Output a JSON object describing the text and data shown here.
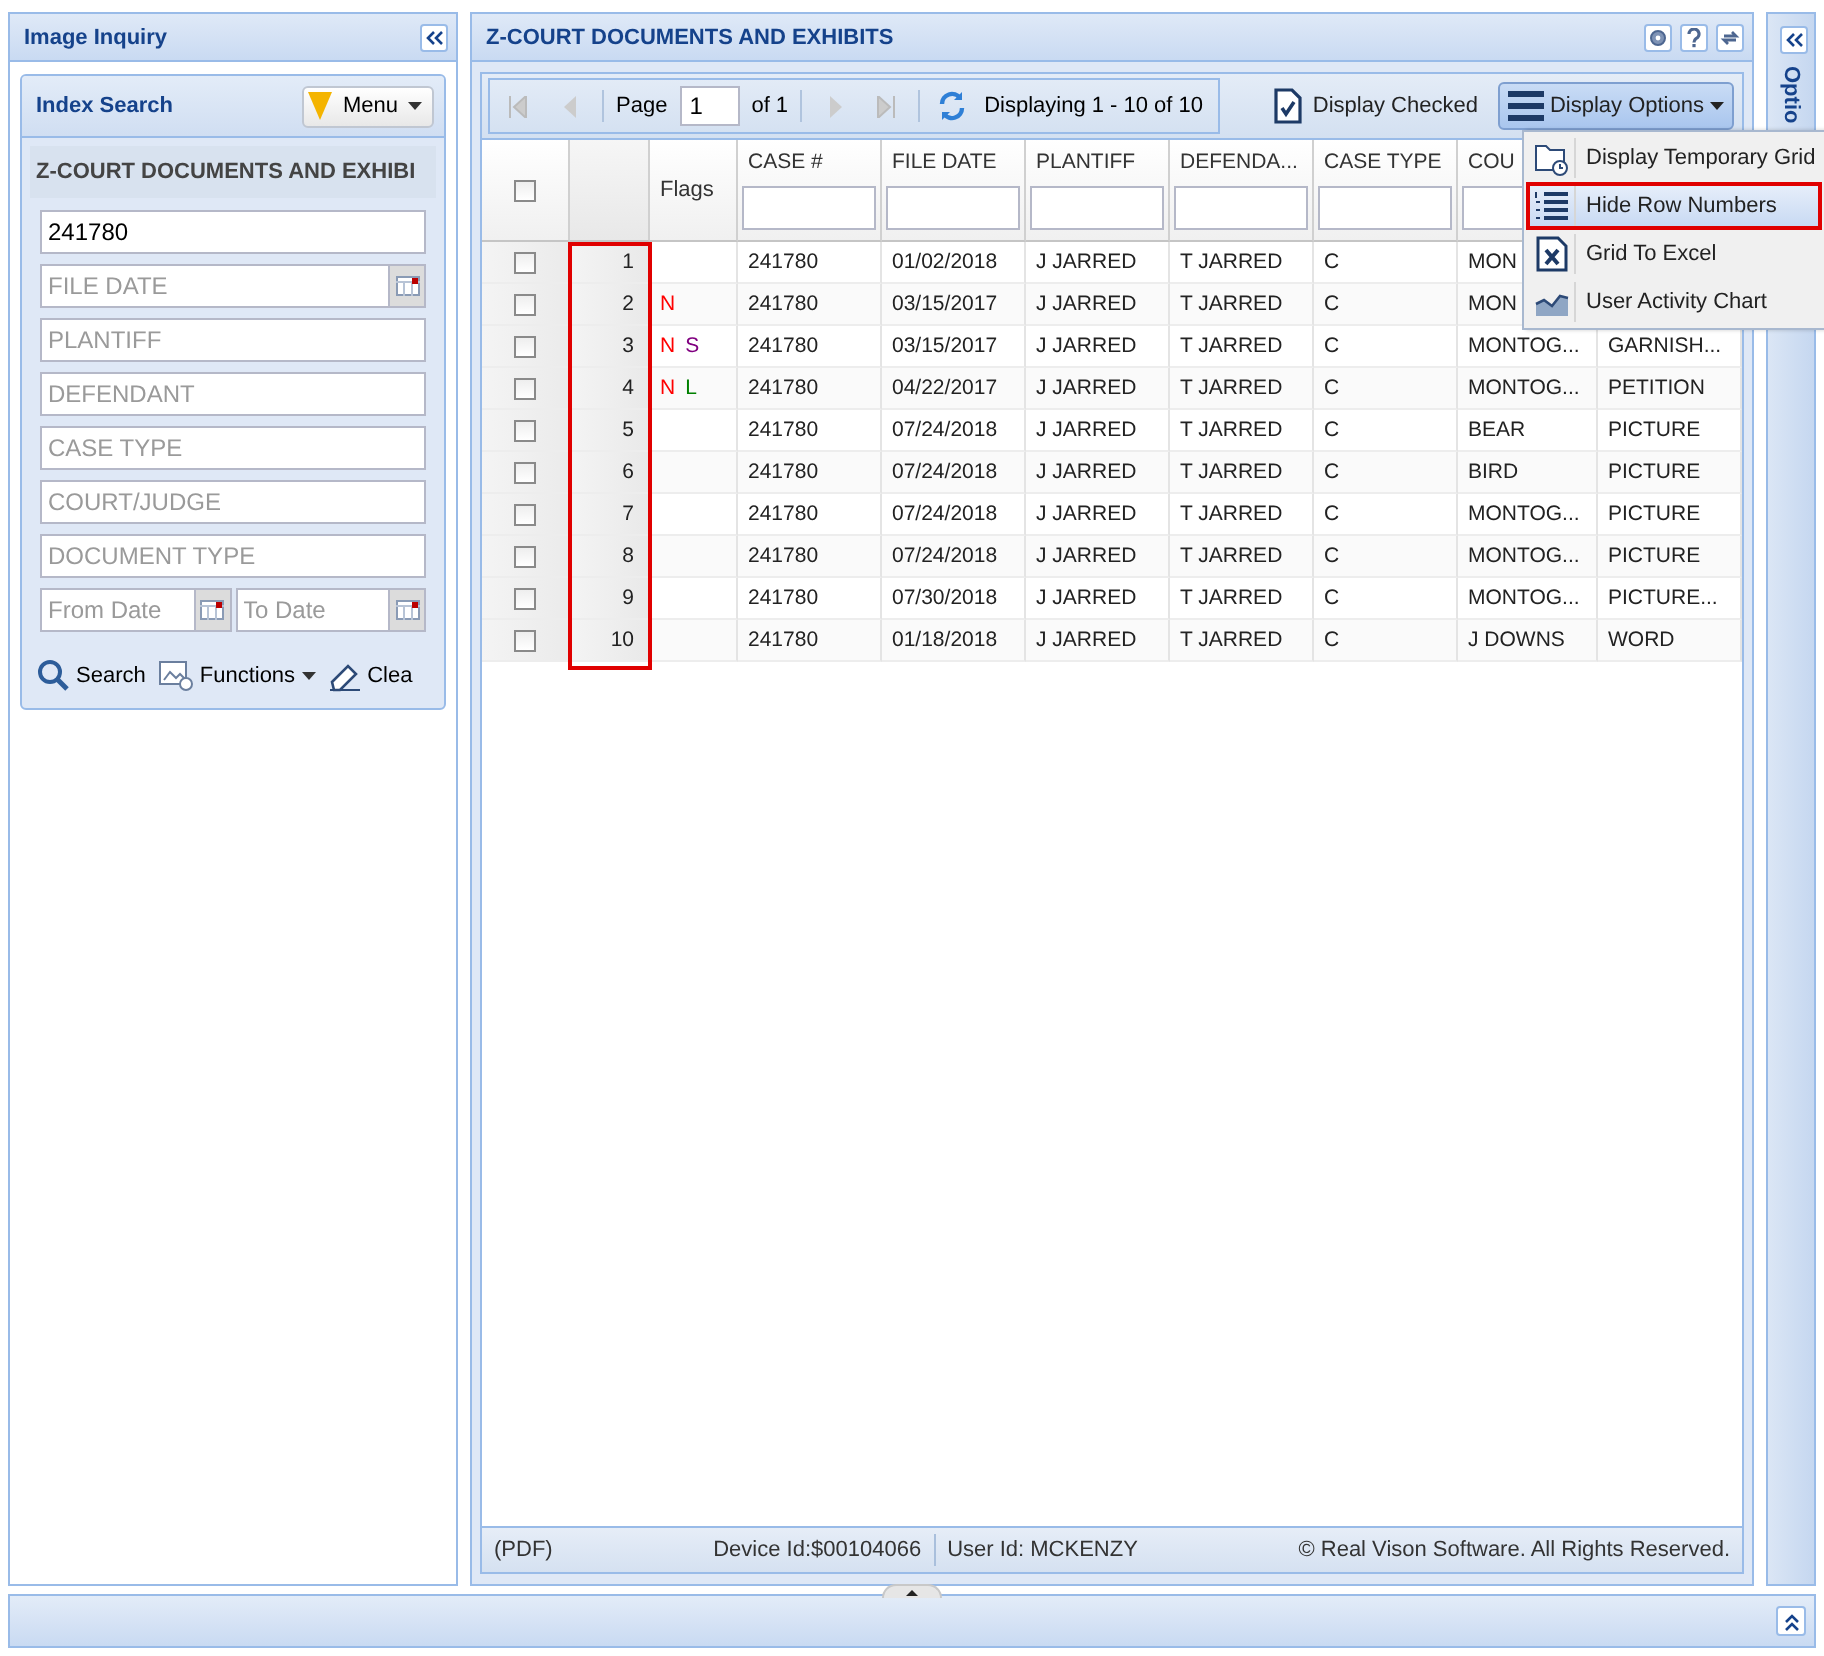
{
  "left_panel": {
    "title": "Image Inquiry",
    "index_search": {
      "title": "Index Search",
      "menu_button": "Menu",
      "section_title": "Z-COURT DOCUMENTS AND EXHIBI",
      "fields": [
        {
          "kind": "text",
          "value": "241780"
        },
        {
          "kind": "date",
          "placeholder": "FILE DATE"
        },
        {
          "kind": "text",
          "placeholder": "PLANTIFF"
        },
        {
          "kind": "text",
          "placeholder": "DEFENDANT"
        },
        {
          "kind": "text",
          "placeholder": "CASE TYPE"
        },
        {
          "kind": "text",
          "placeholder": "COURT/JUDGE"
        },
        {
          "kind": "text",
          "placeholder": "DOCUMENT TYPE"
        }
      ],
      "date_range": [
        {
          "placeholder": "From Date"
        },
        {
          "placeholder": "To Date"
        }
      ],
      "actions": [
        {
          "kind": "search",
          "label": "Search"
        },
        {
          "kind": "functions",
          "label": "Functions"
        },
        {
          "kind": "clear",
          "label": "Clea"
        }
      ]
    }
  },
  "main_panel": {
    "title": "Z-COURT DOCUMENTS AND EXHIBITS",
    "toolbar": {
      "page_label": "Page",
      "page": "1",
      "page_count": "of 1",
      "displaying": "Displaying 1 - 10 of 10",
      "display_checked": "Display Checked",
      "display_options": "Display Options"
    },
    "grid": {
      "all_checked": false,
      "row_numbers_highlighted": true,
      "flags_header": "Flags",
      "columns": [
        {
          "label": "CASE #"
        },
        {
          "label": "FILE DATE"
        },
        {
          "label": "PLANTIFF"
        },
        {
          "label": "DEFENDA..."
        },
        {
          "label": "CASE TYPE"
        },
        {
          "label": "COU"
        }
      ],
      "rows": [
        {
          "checked": false,
          "number": "1",
          "flags": [],
          "cells": [
            "241780",
            "01/02/2018",
            "J JARRED",
            "T JARRED",
            "C",
            "MON"
          ]
        },
        {
          "checked": false,
          "number": "2",
          "flags": [
            {
              "text": "N",
              "color": "#ff0000"
            }
          ],
          "cells": [
            "241780",
            "03/15/2017",
            "J JARRED",
            "T JARRED",
            "C",
            "MON"
          ]
        },
        {
          "checked": false,
          "number": "3",
          "flags": [
            {
              "text": "N",
              "color": "#ff0000"
            },
            {
              "text": "S",
              "color": "#800080"
            }
          ],
          "cells": [
            "241780",
            "03/15/2017",
            "J JARRED",
            "T JARRED",
            "C",
            "MONTOG...",
            "GARNISH..."
          ]
        },
        {
          "checked": false,
          "number": "4",
          "flags": [
            {
              "text": "N",
              "color": "#ff0000"
            },
            {
              "text": "L",
              "color": "#008000"
            }
          ],
          "cells": [
            "241780",
            "04/22/2017",
            "J JARRED",
            "T JARRED",
            "C",
            "MONTOG...",
            "PETITION"
          ]
        },
        {
          "checked": false,
          "number": "5",
          "flags": [],
          "cells": [
            "241780",
            "07/24/2018",
            "J JARRED",
            "T JARRED",
            "C",
            "BEAR",
            "PICTURE"
          ]
        },
        {
          "checked": false,
          "number": "6",
          "flags": [],
          "cells": [
            "241780",
            "07/24/2018",
            "J JARRED",
            "T JARRED",
            "C",
            "BIRD",
            "PICTURE"
          ]
        },
        {
          "checked": false,
          "number": "7",
          "flags": [],
          "cells": [
            "241780",
            "07/24/2018",
            "J JARRED",
            "T JARRED",
            "C",
            "MONTOG...",
            "PICTURE"
          ]
        },
        {
          "checked": false,
          "number": "8",
          "flags": [],
          "cells": [
            "241780",
            "07/24/2018",
            "J JARRED",
            "T JARRED",
            "C",
            "MONTOG...",
            "PICTURE"
          ]
        },
        {
          "checked": false,
          "number": "9",
          "flags": [],
          "cells": [
            "241780",
            "07/30/2018",
            "J JARRED",
            "T JARRED",
            "C",
            "MONTOG...",
            "PICTURE..."
          ]
        },
        {
          "checked": false,
          "number": "10",
          "flags": [],
          "cells": [
            "241780",
            "01/18/2018",
            "J JARRED",
            "T JARRED",
            "C",
            "J DOWNS",
            "WORD"
          ]
        }
      ]
    },
    "options_menu": {
      "items": [
        {
          "kind": "temp-grid",
          "label": "Display Temporary Grid",
          "selected": false
        },
        {
          "kind": "row-numbers",
          "label": "Hide Row Numbers",
          "selected": true
        },
        {
          "kind": "excel",
          "label": "Grid To Excel",
          "selected": false
        },
        {
          "kind": "chart",
          "label": "User Activity Chart",
          "selected": false
        }
      ]
    },
    "status_bar": {
      "format": "(PDF)",
      "device": "Device Id:$00104066",
      "user": "User Id: MCKENZY",
      "copyright": "© Real Vison Software. All Rights Reserved."
    }
  },
  "right_panel": {
    "title": "Optio"
  }
}
